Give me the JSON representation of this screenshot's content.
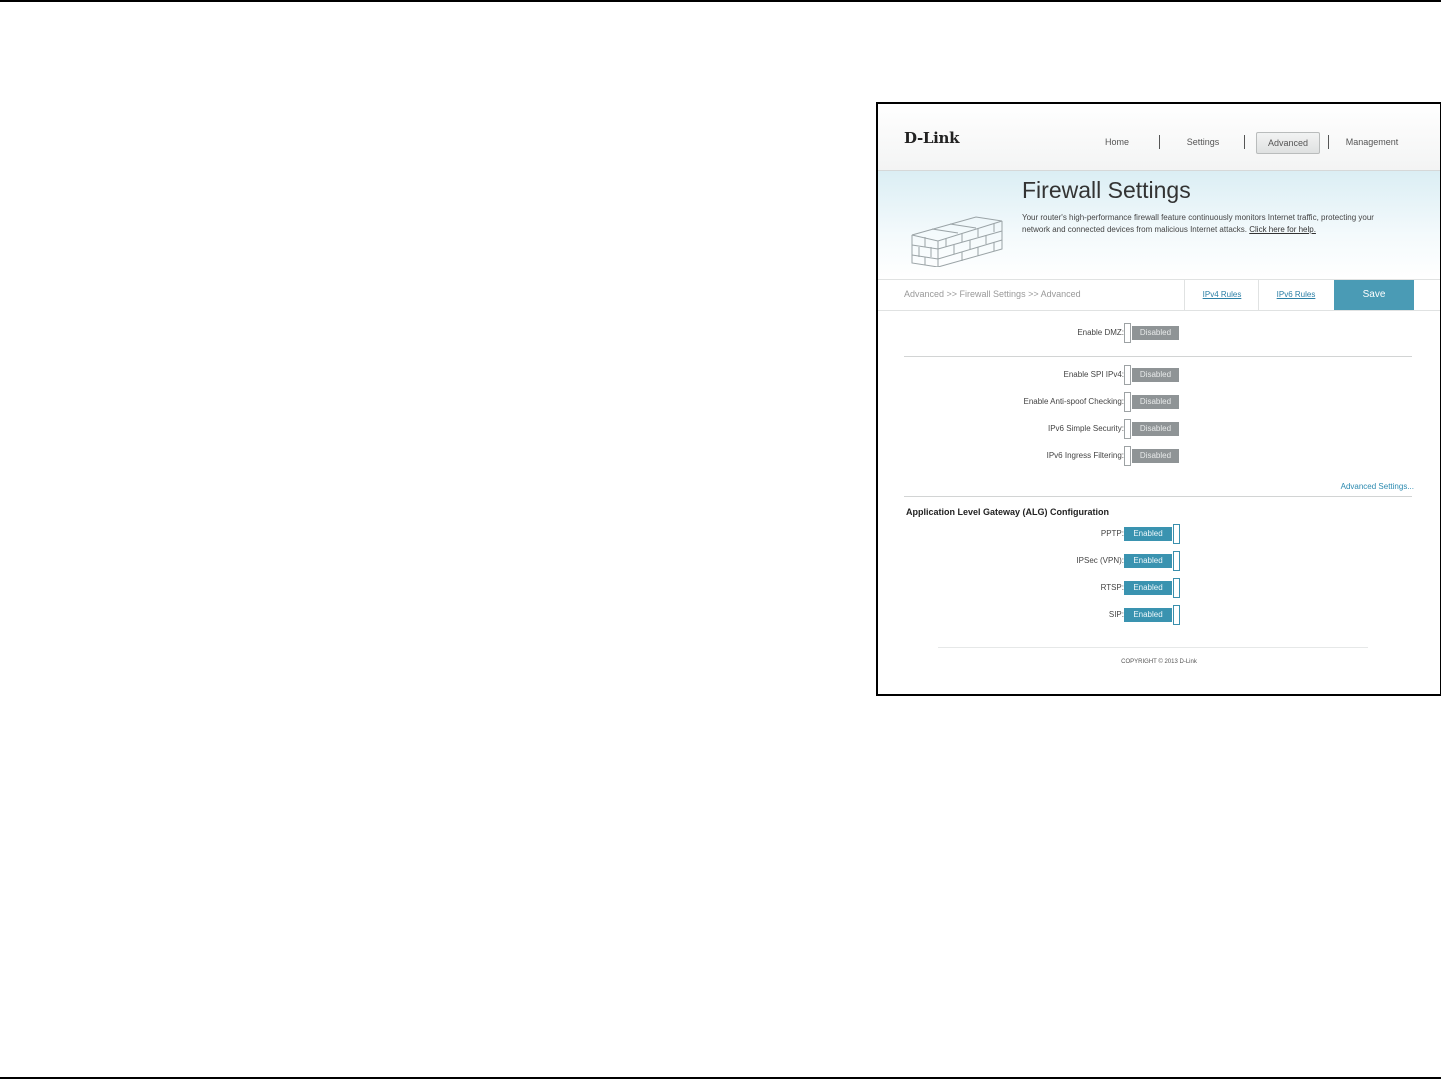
{
  "header": {
    "logo": "D-Link",
    "nav": [
      {
        "label": "Home"
      },
      {
        "label": "Settings"
      },
      {
        "label": "Advanced"
      },
      {
        "label": "Management"
      }
    ]
  },
  "banner": {
    "title": "Firewall Settings",
    "description": "Your router's high-performance firewall feature continuously monitors Internet traffic, protecting your network and connected devices from malicious Internet attacks.",
    "help_link": "Click here for help."
  },
  "subbar": {
    "breadcrumb": "Advanced >> Firewall Settings >> Advanced",
    "ipv4_rules": "IPv4 Rules",
    "ipv6_rules": "IPv6 Rules",
    "save": "Save"
  },
  "dmz": {
    "label": "Enable DMZ:",
    "state": "Disabled"
  },
  "security": [
    {
      "label": "Enable SPI IPv4:",
      "state": "Disabled"
    },
    {
      "label": "Enable Anti-spoof Checking:",
      "state": "Disabled"
    },
    {
      "label": "IPv6 Simple Security:",
      "state": "Disabled"
    },
    {
      "label": "IPv6 Ingress Filtering:",
      "state": "Disabled"
    }
  ],
  "advanced_settings_link": "Advanced Settings...",
  "alg": {
    "title": "Application Level Gateway (ALG) Configuration",
    "items": [
      {
        "label": "PPTP:",
        "state": "Enabled"
      },
      {
        "label": "IPSec (VPN):",
        "state": "Enabled"
      },
      {
        "label": "RTSP:",
        "state": "Enabled"
      },
      {
        "label": "SIP:",
        "state": "Enabled"
      }
    ]
  },
  "footer": {
    "copyright": "COPYRIGHT © 2013 D-Link"
  },
  "colors": {
    "accent": "#4a9bb5",
    "toggle_off": "#8f9496",
    "toggle_on": "#3a93b0"
  }
}
